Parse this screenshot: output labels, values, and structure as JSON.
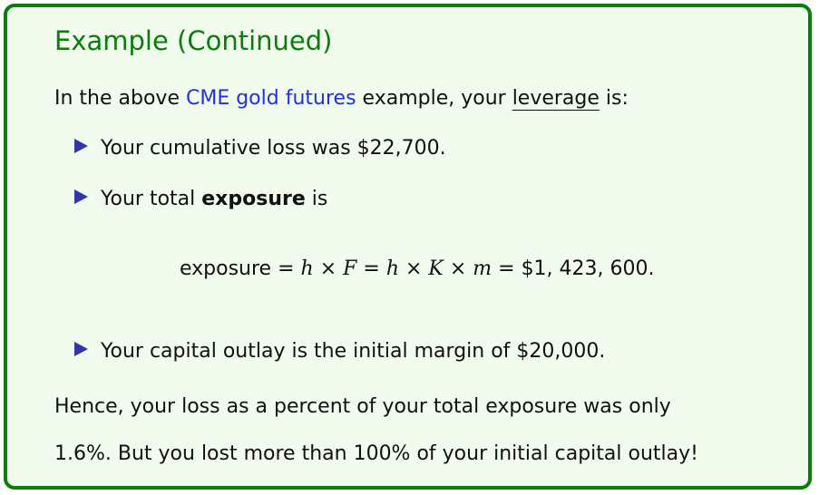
{
  "title": "Example (Continued)",
  "intro": {
    "before": "In the above ",
    "link": "CME gold futures",
    "middle": " example, your ",
    "underlined": "leverage",
    "after": " is:"
  },
  "items": [
    {
      "text": "Your cumulative loss was $22,700."
    },
    {
      "before": "Your total ",
      "bold": "exposure",
      "after": " is"
    },
    {
      "text": "Your capital outlay is the initial margin of $20,000."
    }
  ],
  "formula": {
    "label": "exposure",
    "eq1": " = ",
    "h": "h",
    "times": " × ",
    "F": "F",
    "eq2": " = ",
    "K": "K",
    "m": "m",
    "eq3": " = ",
    "value": "$1, 423, 600."
  },
  "conclusion": {
    "line1": "Hence, your loss as a percent of your total exposure was only",
    "line2": "1.6%. But you lost more than 100% of your initial capital outlay!"
  },
  "colors": {
    "frame": "#0a7d0a",
    "background": "#f1fbee",
    "link": "#1f2ef2",
    "bullet": "#3135a8"
  }
}
